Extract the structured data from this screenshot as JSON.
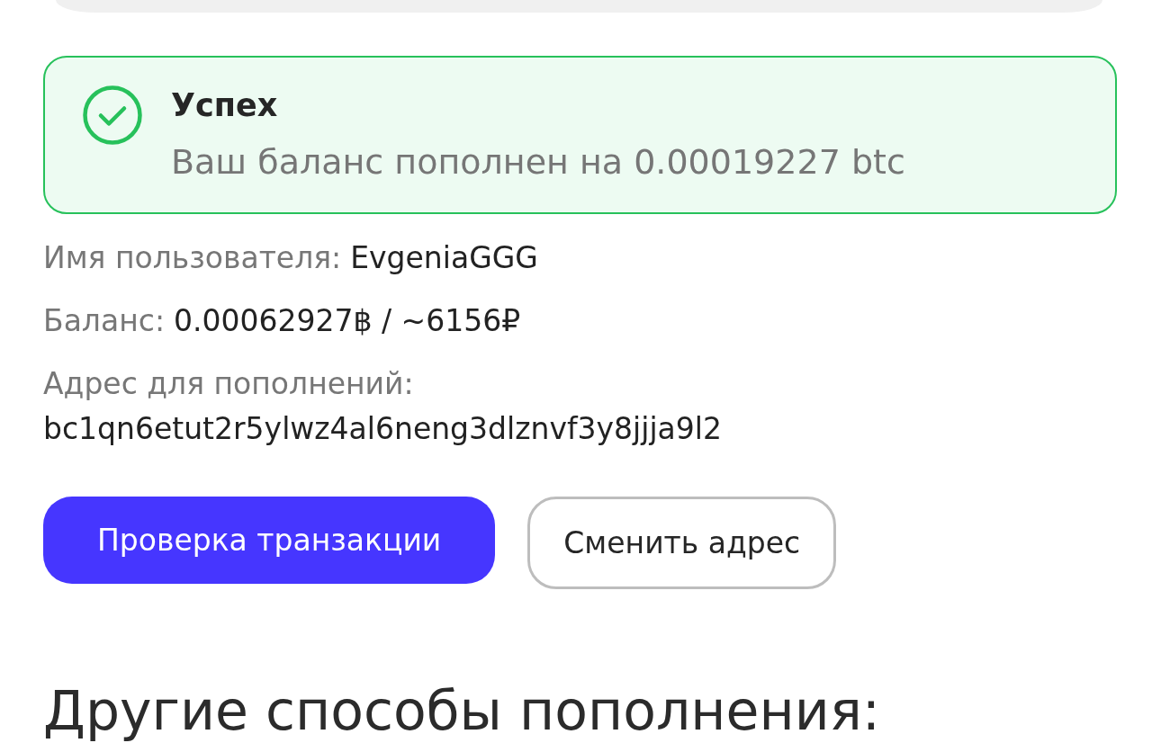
{
  "alert": {
    "kind": "success",
    "title": "Успех",
    "message": "Ваш баланс пополнен на 0.00019227 btc"
  },
  "account": {
    "fields": [
      {
        "label": "Имя пользователя:",
        "value": "EvgeniaGGG"
      },
      {
        "label": "Баланс:",
        "value": "0.00062927฿ / ~6156₽"
      }
    ],
    "address": {
      "label": "Адрес для пополнений:",
      "value": "bc1qn6etut2r5ylwz4al6neng3dlznvf3y8jjja9l2"
    }
  },
  "buttons": [
    {
      "label": "Проверка транзакции",
      "kind": "primary"
    },
    {
      "label": "Сменить адрес",
      "kind": "secondary"
    }
  ],
  "section_heading": "Другие способы пополнения:"
}
